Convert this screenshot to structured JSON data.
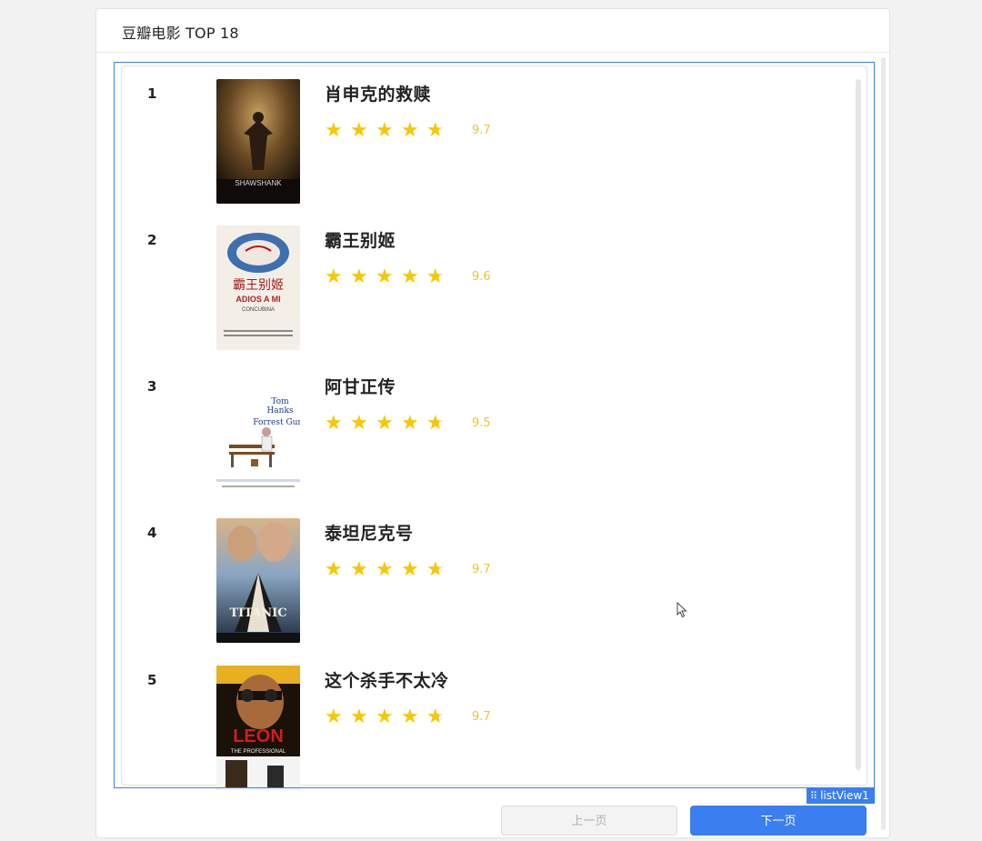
{
  "header": {
    "title": "豆瓣电影 TOP 18"
  },
  "listview": {
    "tag_label": "listView1"
  },
  "movies": [
    {
      "rank": "1",
      "title": "肖申克的救赎",
      "score": "9.7",
      "stars": 4.5,
      "poster_label": "SHAWSHANK"
    },
    {
      "rank": "2",
      "title": "霸王别姬",
      "score": "9.6",
      "stars": 4.5,
      "poster_label": "ADIOS A MI"
    },
    {
      "rank": "3",
      "title": "阿甘正传",
      "score": "9.5",
      "stars": 4.5,
      "poster_label": "Forrest Gump"
    },
    {
      "rank": "4",
      "title": "泰坦尼克号",
      "score": "9.7",
      "stars": 4.5,
      "poster_label": "TITANIC"
    },
    {
      "rank": "5",
      "title": "这个杀手不太冷",
      "score": "9.7",
      "stars": 4.5,
      "poster_label": "LEON"
    }
  ],
  "pagination": {
    "prev_label": "上一页",
    "next_label": "下一页"
  },
  "colors": {
    "accent": "#3a7ef0",
    "star": "#f7c700",
    "score": "#f0c429"
  }
}
